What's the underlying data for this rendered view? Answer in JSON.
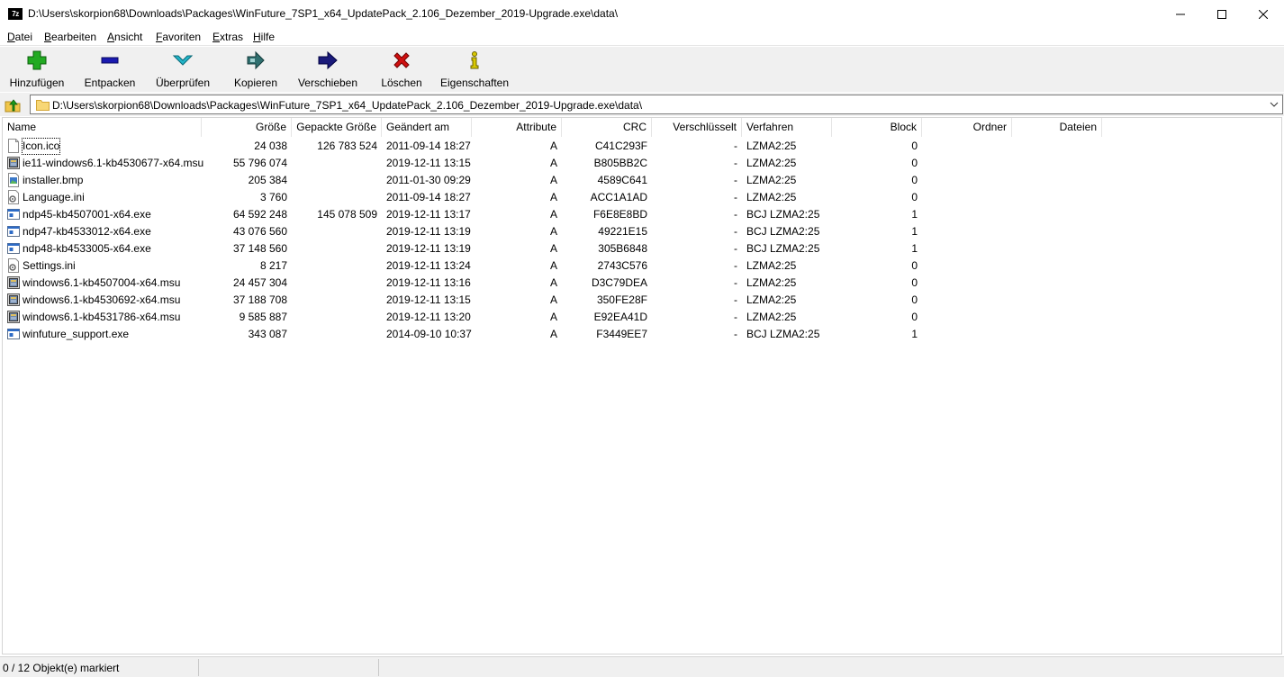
{
  "window": {
    "app_icon_text": "7z",
    "title": "D:\\Users\\skorpion68\\Downloads\\Packages\\WinFuture_7SP1_x64_UpdatePack_2.106_Dezember_2019-Upgrade.exe\\data\\"
  },
  "menu": [
    "Datei",
    "Bearbeiten",
    "Ansicht",
    "Favoriten",
    "Extras",
    "Hilfe"
  ],
  "toolbar": [
    {
      "label": "Hinzufügen",
      "icon": "plus-icon",
      "color": "#22aa22"
    },
    {
      "label": "Entpacken",
      "icon": "minus-icon",
      "color": "#1a1ab0"
    },
    {
      "label": "Überprüfen",
      "icon": "check-down-arrow-icon",
      "color": "#22b4c8"
    },
    {
      "label": "Kopieren",
      "icon": "copy-arrow-icon",
      "color": "#2f6f6f"
    },
    {
      "label": "Verschieben",
      "icon": "move-arrow-icon",
      "color": "#1a1a7a"
    },
    {
      "label": "Löschen",
      "icon": "delete-x-icon",
      "color": "#d01010"
    },
    {
      "label": "Eigenschaften",
      "icon": "info-icon",
      "color": "#d8c800"
    }
  ],
  "address": {
    "path": "D:\\Users\\skorpion68\\Downloads\\Packages\\WinFuture_7SP1_x64_UpdatePack_2.106_Dezember_2019-Upgrade.exe\\data\\"
  },
  "columns": [
    "Name",
    "Größe",
    "Gepackte Größe",
    "Geändert am",
    "Attribute",
    "CRC",
    "Verschlüsselt",
    "Verfahren",
    "Block",
    "Ordner",
    "Dateien"
  ],
  "files": [
    {
      "name": "Icon.ico",
      "icon": "blank-file-icon",
      "size": "24 038",
      "packed": "126 783 524",
      "modified": "2011-09-14 18:27",
      "attr": "A",
      "crc": "C41C293F",
      "enc": "-",
      "method": "LZMA2:25",
      "block": "0"
    },
    {
      "name": "ie11-windows6.1-kb4530677-x64.msu",
      "icon": "msu-package-icon",
      "size": "55 796 074",
      "packed": "",
      "modified": "2019-12-11 13:15",
      "attr": "A",
      "crc": "B805BB2C",
      "enc": "-",
      "method": "LZMA2:25",
      "block": "0"
    },
    {
      "name": "installer.bmp",
      "icon": "image-file-icon",
      "size": "205 384",
      "packed": "",
      "modified": "2011-01-30 09:29",
      "attr": "A",
      "crc": "4589C641",
      "enc": "-",
      "method": "LZMA2:25",
      "block": "0"
    },
    {
      "name": "Language.ini",
      "icon": "settings-file-icon",
      "size": "3 760",
      "packed": "",
      "modified": "2011-09-14 18:27",
      "attr": "A",
      "crc": "ACC1A1AD",
      "enc": "-",
      "method": "LZMA2:25",
      "block": "0"
    },
    {
      "name": "ndp45-kb4507001-x64.exe",
      "icon": "exe-file-icon",
      "size": "64 592 248",
      "packed": "145 078 509",
      "modified": "2019-12-11 13:17",
      "attr": "A",
      "crc": "F6E8E8BD",
      "enc": "-",
      "method": "BCJ LZMA2:25",
      "block": "1"
    },
    {
      "name": "ndp47-kb4533012-x64.exe",
      "icon": "exe-file-icon",
      "size": "43 076 560",
      "packed": "",
      "modified": "2019-12-11 13:19",
      "attr": "A",
      "crc": "49221E15",
      "enc": "-",
      "method": "BCJ LZMA2:25",
      "block": "1"
    },
    {
      "name": "ndp48-kb4533005-x64.exe",
      "icon": "exe-file-icon",
      "size": "37 148 560",
      "packed": "",
      "modified": "2019-12-11 13:19",
      "attr": "A",
      "crc": "305B6848",
      "enc": "-",
      "method": "BCJ LZMA2:25",
      "block": "1"
    },
    {
      "name": "Settings.ini",
      "icon": "settings-file-icon",
      "size": "8 217",
      "packed": "",
      "modified": "2019-12-11 13:24",
      "attr": "A",
      "crc": "2743C576",
      "enc": "-",
      "method": "LZMA2:25",
      "block": "0"
    },
    {
      "name": "windows6.1-kb4507004-x64.msu",
      "icon": "msu-package-icon",
      "size": "24 457 304",
      "packed": "",
      "modified": "2019-12-11 13:16",
      "attr": "A",
      "crc": "D3C79DEA",
      "enc": "-",
      "method": "LZMA2:25",
      "block": "0"
    },
    {
      "name": "windows6.1-kb4530692-x64.msu",
      "icon": "msu-package-icon",
      "size": "37 188 708",
      "packed": "",
      "modified": "2019-12-11 13:15",
      "attr": "A",
      "crc": "350FE28F",
      "enc": "-",
      "method": "LZMA2:25",
      "block": "0"
    },
    {
      "name": "windows6.1-kb4531786-x64.msu",
      "icon": "msu-package-icon",
      "size": "9 585 887",
      "packed": "",
      "modified": "2019-12-11 13:20",
      "attr": "A",
      "crc": "E92EA41D",
      "enc": "-",
      "method": "LZMA2:25",
      "block": "0"
    },
    {
      "name": "winfuture_support.exe",
      "icon": "exe-file-icon",
      "size": "343 087",
      "packed": "",
      "modified": "2014-09-10 10:37",
      "attr": "A",
      "crc": "F3449EE7",
      "enc": "-",
      "method": "BCJ LZMA2:25",
      "block": "1"
    }
  ],
  "status": {
    "selection": "0 / 12 Objekt(e) markiert"
  }
}
